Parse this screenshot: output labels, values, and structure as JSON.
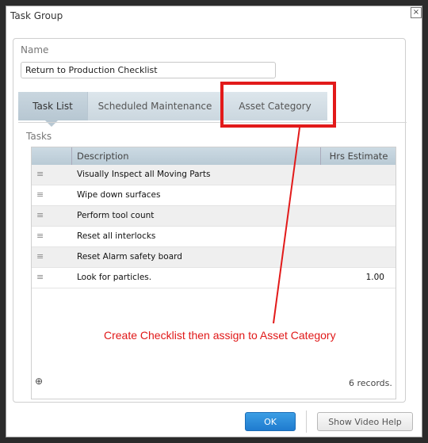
{
  "dialog": {
    "title": "Task Group",
    "close_glyph": "×",
    "close_icon": "close-icon"
  },
  "form": {
    "name_label": "Name",
    "name_value": "Return to Production Checklist"
  },
  "tabs": [
    {
      "label": "Task List",
      "active": true
    },
    {
      "label": "Scheduled Maintenance",
      "active": false
    },
    {
      "label": "Asset Category",
      "active": false
    }
  ],
  "tasks": {
    "label": "Tasks",
    "columns": [
      "Description",
      "Hrs Estimate"
    ],
    "rows": [
      {
        "handle": "≡",
        "description": "Visually Inspect all Moving Parts",
        "hrs": ""
      },
      {
        "handle": "≡",
        "description": "Wipe down surfaces",
        "hrs": ""
      },
      {
        "handle": "≡",
        "description": "Perform tool count",
        "hrs": ""
      },
      {
        "handle": "≡",
        "description": "Reset all interlocks",
        "hrs": ""
      },
      {
        "handle": "≡",
        "description": "Reset Alarm safety board",
        "hrs": ""
      },
      {
        "handle": "≡",
        "description": "Look for particles.",
        "hrs": "1.00"
      }
    ],
    "add_glyph": "⊕",
    "add_icon": "add-row-icon",
    "records_text": "6 records."
  },
  "annotation": {
    "text": "Create Checklist then assign to Asset Category",
    "color": "#e01818"
  },
  "buttons": {
    "ok": "OK",
    "help": "Show Video Help"
  },
  "colors": {
    "accent": "#1f7bcf",
    "header": "#c4d3dd",
    "highlight": "#e21a1a"
  }
}
